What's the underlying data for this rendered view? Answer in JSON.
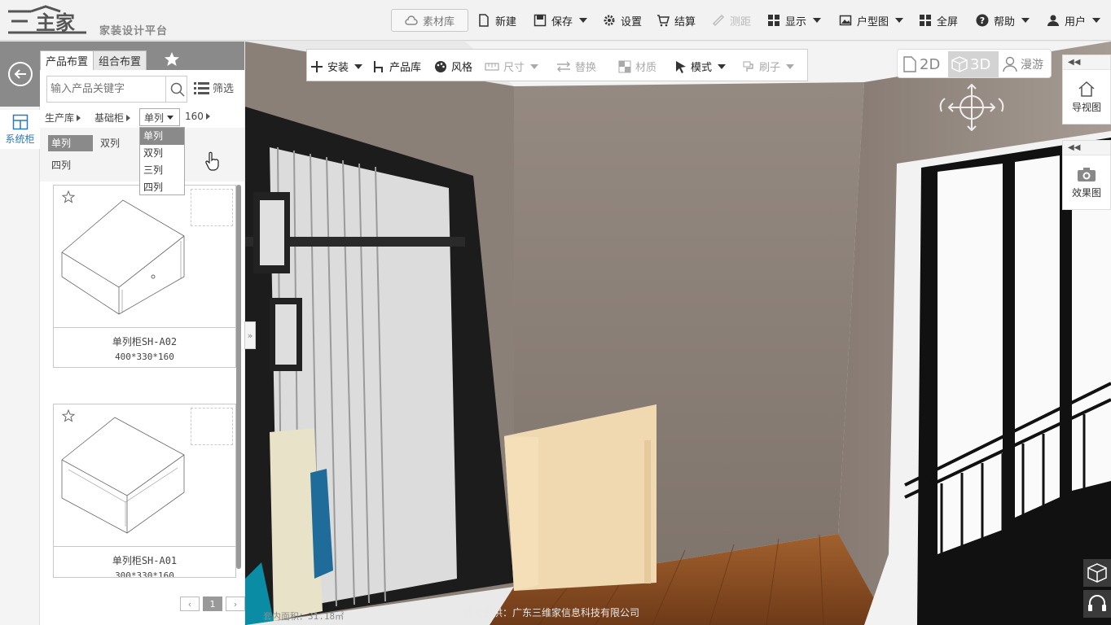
{
  "header": {
    "brand": "三维家",
    "brand_sub": "家装设计平台",
    "material_btn": "素材库",
    "items": {
      "new": "新建",
      "save": "保存",
      "settings": "设置",
      "checkout": "结算",
      "measure": "测距",
      "display": "显示",
      "floorplan": "户型图",
      "fullscreen": "全屏",
      "help": "帮助",
      "user": "用户"
    }
  },
  "rail": {
    "system_cabinet": "系统柜"
  },
  "panel": {
    "tabs": [
      "产品布置",
      "组合布置"
    ],
    "search_placeholder": "输入产品关键字",
    "filter": "筛选",
    "breadcrumb": [
      "生产库",
      "基础柜",
      "单列",
      "160"
    ],
    "dropdown_options": [
      "单列",
      "双列",
      "三列",
      "四列"
    ],
    "filter_chips": [
      "单列",
      "双列",
      "四列"
    ],
    "products": [
      {
        "name": "单列柜SH-A02",
        "dims": "400*330*160"
      },
      {
        "name": "单列柜SH-A01",
        "dims": "300*330*160"
      }
    ],
    "pager": {
      "prev": "‹",
      "page": "1",
      "next": "›"
    }
  },
  "toolbar": {
    "install": "安装",
    "library": "产品库",
    "style": "风格",
    "size": "尺寸",
    "replace": "替换",
    "material": "材质",
    "mode": "模式",
    "brush": "刷子"
  },
  "view": {
    "mode_2d": "2D",
    "mode_3d": "3D",
    "roam": "漫游",
    "nav_map": "导视图",
    "render": "效果图"
  },
  "footer": {
    "tech": "技术提供：广东三维家信息科技有限公司",
    "area": "套内面积：31.18㎡"
  },
  "colors": {
    "accent": "#2a7ab8",
    "panel_header": "#8a8a8a",
    "wall": "#8b8078",
    "cabinet": "#f2dcb5",
    "floor": "#8e5228"
  }
}
